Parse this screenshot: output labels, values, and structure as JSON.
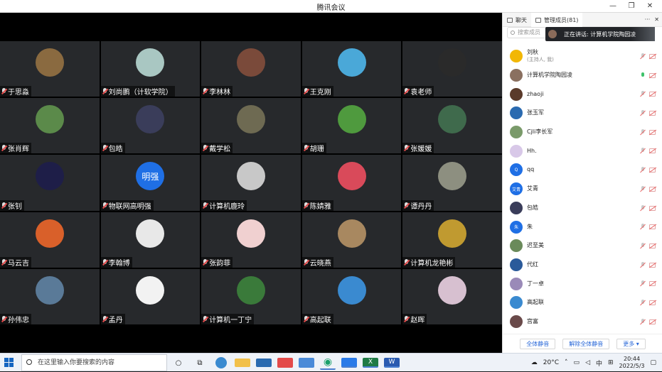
{
  "window": {
    "title": "腾讯会议",
    "minimize": "—",
    "restore": "❐",
    "close": "✕"
  },
  "grid": [
    {
      "name": "于思淼",
      "bg": "#8a6a40"
    },
    {
      "name": "刘尚鹏（计软学院）",
      "bg": "#a9c7c2"
    },
    {
      "name": "李林林",
      "bg": "#7a4a3a"
    },
    {
      "name": "王克刚",
      "bg": "#4aa8d8"
    },
    {
      "name": "袁老师",
      "bg": "#2a2a2a"
    },
    {
      "name": "张肖辉",
      "bg": "#5b8a4a"
    },
    {
      "name": "包皓",
      "bg": "#3a3d5a"
    },
    {
      "name": "戴学松",
      "bg": "#6e6a52"
    },
    {
      "name": "胡珊",
      "bg": "#4f9a3e"
    },
    {
      "name": "张媛媛",
      "bg": "#3f6a4c"
    },
    {
      "name": "张钊",
      "bg": "#1e1e48"
    },
    {
      "name": "物联网高明强",
      "bg": "#1f6fe5",
      "initials": "明强"
    },
    {
      "name": "计算机鹿玲",
      "bg": "#c8c8c8"
    },
    {
      "name": "陈婧雅",
      "bg": "#d94a5a"
    },
    {
      "name": "谭丹丹",
      "bg": "#8d8f80"
    },
    {
      "name": "马云吉",
      "bg": "#d9602a"
    },
    {
      "name": "李翰博",
      "bg": "#e8e8e8"
    },
    {
      "name": "张韵菲",
      "bg": "#f0d0d0"
    },
    {
      "name": "云晓燕",
      "bg": "#a88860"
    },
    {
      "name": "计算机龙艳彬",
      "bg": "#c09a30"
    },
    {
      "name": "孙伟忠",
      "bg": "#5a7a98"
    },
    {
      "name": "孟丹",
      "bg": "#f2f2f2"
    },
    {
      "name": "计算机一丁宁",
      "bg": "#3a7a3a"
    },
    {
      "name": "高起联",
      "bg": "#3a8ad0"
    },
    {
      "name": "赵晖",
      "bg": "#d7c0d0"
    }
  ],
  "panel": {
    "chat_tab": "聊天",
    "members_tab": "管理成员(81)",
    "more": "···",
    "search_placeholder": "搜索成员",
    "speaking": "正在讲话: 计算机学院陶园凌",
    "members": [
      {
        "name": "刘秋",
        "sub": "(主持人, 我)",
        "bg": "#f2b705",
        "mic": "off"
      },
      {
        "name": "计算机学院陶园凌",
        "bg": "#8a7060",
        "mic": "on"
      },
      {
        "name": "zhaoji",
        "bg": "#5a3a2a",
        "mic": "off"
      },
      {
        "name": "张玉军",
        "bg": "#2a6ab0",
        "mic": "off"
      },
      {
        "name": "Cjli李长军",
        "bg": "#7a9a6a",
        "mic": "off"
      },
      {
        "name": "Hh.",
        "bg": "#d8c8e8",
        "mic": "off"
      },
      {
        "name": "qq",
        "bg": "#1f6fe5",
        "initials": "Q",
        "mic": "off"
      },
      {
        "name": "艾青",
        "bg": "#1f6fe5",
        "initials": "艾青",
        "mic": "off"
      },
      {
        "name": "包皓",
        "bg": "#3a3d5a",
        "mic": "off"
      },
      {
        "name": "朱",
        "bg": "#1f6fe5",
        "initials": "朱",
        "mic": "off"
      },
      {
        "name": "迟至美",
        "bg": "#6a8a5a",
        "mic": "off"
      },
      {
        "name": "代红",
        "bg": "#2a5a9a",
        "mic": "off"
      },
      {
        "name": "丁一卓",
        "bg": "#9a8ab8",
        "mic": "off"
      },
      {
        "name": "高起联",
        "bg": "#3a8ad0",
        "mic": "off"
      },
      {
        "name": "宫富",
        "bg": "#6a4a4a",
        "mic": "off"
      }
    ],
    "mute_all": "全体静音",
    "unmute_all": "解除全体静音",
    "more_btn": "更多 ▾"
  },
  "taskbar": {
    "search_placeholder": "在这里输入你要搜索的内容",
    "weather": "20°C",
    "ime": "中",
    "time": "20:44",
    "date": "2022/5/3"
  }
}
